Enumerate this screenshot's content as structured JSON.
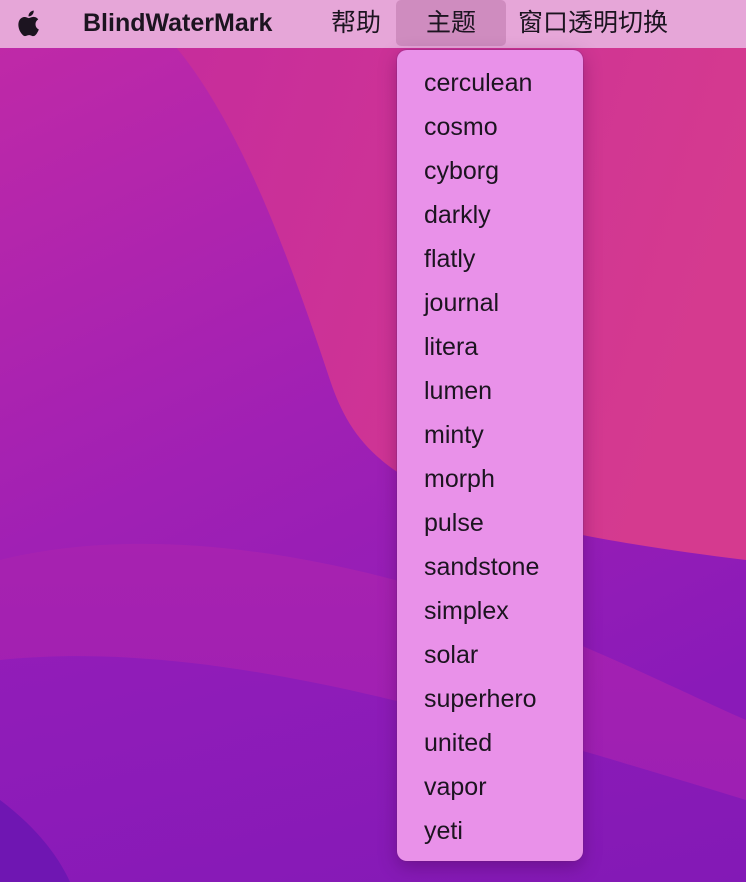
{
  "menubar": {
    "apple_icon": "apple-logo-icon",
    "app_name": "BlindWaterMark",
    "items": [
      "帮助",
      "主题",
      "窗口透明切换"
    ],
    "active_item": "主题"
  },
  "theme_menu": {
    "items": [
      "cerculean",
      "cosmo",
      "cyborg",
      "darkly",
      "flatly",
      "journal",
      "litera",
      "lumen",
      "minty",
      "morph",
      "pulse",
      "sandstone",
      "simplex",
      "solar",
      "superhero",
      "united",
      "vapor",
      "yeti"
    ]
  },
  "colors": {
    "menubar": "#e6a6d8",
    "menu_highlight": "#cf8cbf",
    "dropdown_bg": "#e991e9",
    "text": "#1c1420",
    "wallpaper_top": "#cc2f9e",
    "wallpaper_bottom": "#8a1ab8"
  }
}
